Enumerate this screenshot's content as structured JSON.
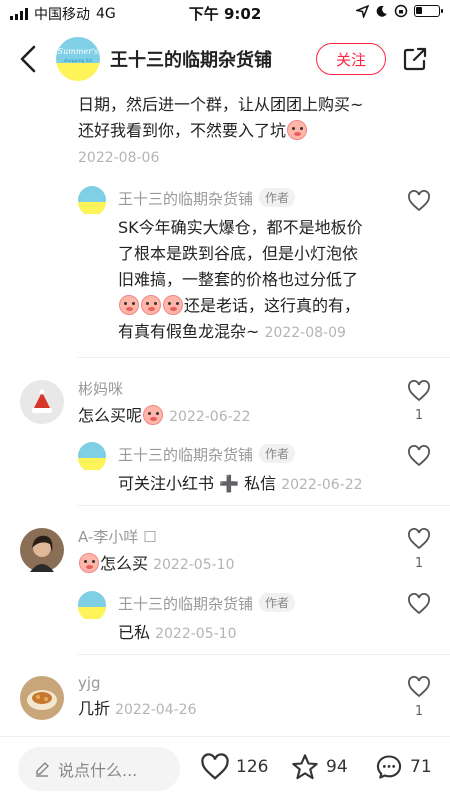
{
  "status": {
    "carrier": "中国移动",
    "network": "4G",
    "time": "下午 9:02"
  },
  "header": {
    "shop_name": "王十三的临期杂货铺",
    "follow_label": "关注",
    "avatar_text_1": "Summer's",
    "avatar_text_2": "shopping list"
  },
  "thread": {
    "parent_text_1": "日期，然后进一个群，让从团团上购买~",
    "parent_text_2": "还好我看到你，不然要入了坑",
    "parent_date": "2022-08-06",
    "reply": {
      "name": "王十三的临期杂货铺",
      "tag": "作者",
      "line1": "SK今年确实大爆仓，都不是地板价",
      "line2": "了根本是跌到谷底，但是小灯泡依",
      "line3": "旧难搞，一整套的价格也过分低了",
      "line4": "还是老话，这行真的有，",
      "line5": "有真有假鱼龙混杂~",
      "date": "2022-08-09"
    }
  },
  "comments": [
    {
      "name": "彬妈咪",
      "text": "怎么买呢",
      "date": "2022-06-22",
      "likes": "1",
      "reply": {
        "name": "王十三的临期杂货铺",
        "tag": "作者",
        "text": "可关注小红书 ➕ 私信",
        "date": "2022-06-22"
      }
    },
    {
      "name": "A-李小咩 ☐",
      "text": "怎么买",
      "date": "2022-05-10",
      "likes": "1",
      "reply": {
        "name": "王十三的临期杂货铺",
        "tag": "作者",
        "text": "已私",
        "date": "2022-05-10"
      }
    },
    {
      "name": "yjg",
      "text": "几折",
      "date": "2022-04-26",
      "likes": "1"
    }
  ],
  "bottom": {
    "placeholder": "说点什么...",
    "likes": "126",
    "stars": "94",
    "comments": "71"
  },
  "colors": {
    "accent": "#ff2442",
    "muted": "#b4b4b4"
  }
}
